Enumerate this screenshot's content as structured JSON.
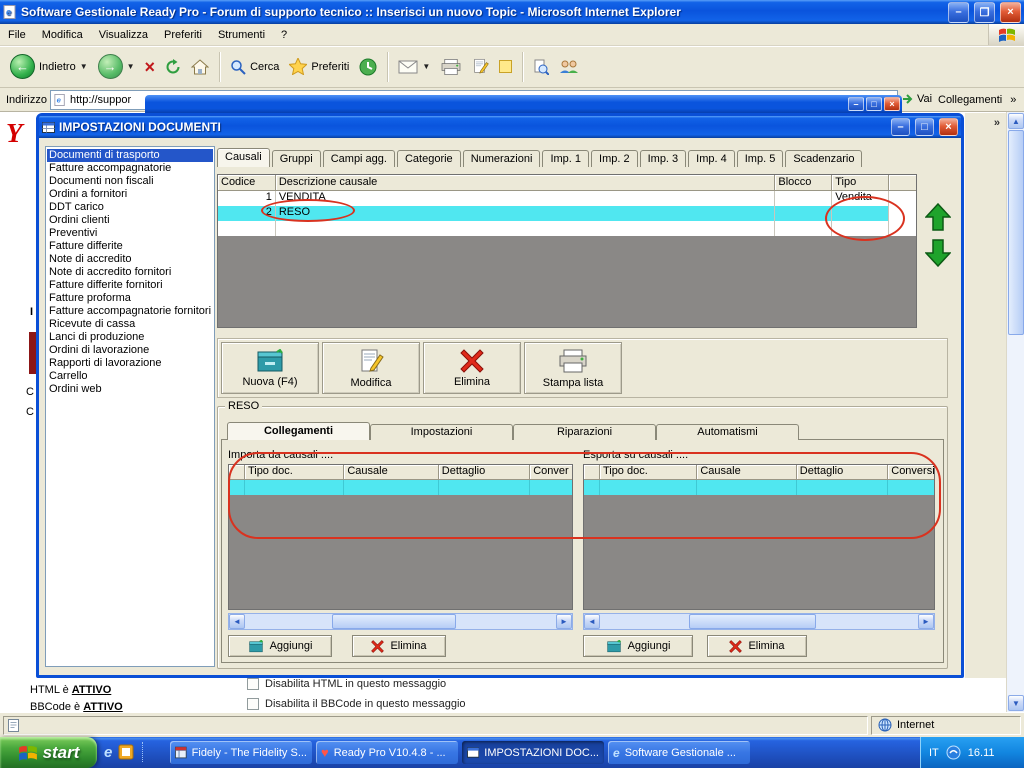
{
  "colors": {
    "titlebar_blue": "#0a54dd",
    "selection_cyan": "#50e7f0",
    "selection_navy": "#2456c9",
    "annotation_red": "#d9321f",
    "taskbar_blue": "#2663e0",
    "start_green": "#2f8a2d",
    "grid_void_gray": "#8a8886"
  },
  "browser": {
    "window_title": "Software Gestionale Ready Pro - Forum di supporto tecnico :: Inserisci un nuovo Topic - Microsoft Internet Explorer",
    "menu_items": [
      "File",
      "Modifica",
      "Visualizza",
      "Preferiti",
      "Strumenti",
      "?"
    ],
    "toolbar": {
      "back": "Indietro",
      "search": "Cerca",
      "favorites": "Preferiti"
    },
    "address": {
      "label": "Indirizzo",
      "value": "http://suppor",
      "go": "Vai",
      "links": "Collegamenti"
    },
    "statusbar": {
      "zone": "Internet"
    }
  },
  "page": {
    "fragments": [
      "Y",
      "I",
      "C",
      "C"
    ],
    "checkbox_html": "Disabilita HTML in questo messaggio",
    "checkbox_bbcode": "Disabilita il BBCode in questo messaggio",
    "html_status_prefix": "HTML è",
    "html_status_value": "ATTIVO",
    "bbcode_status_prefix": "BBCode è",
    "bbcode_status_value": "ATTIVO"
  },
  "dialog": {
    "title": "IMPOSTAZIONI DOCUMENTI",
    "sidebar_items": [
      "Documenti di trasporto",
      "Fatture accompagnatorie",
      "Documenti non fiscali",
      "Ordini a fornitori",
      "DDT carico",
      "Ordini clienti",
      "Preventivi",
      "Fatture differite",
      "Note di accredito",
      "Note di accredito fornitori",
      "Fatture differite fornitori",
      "Fatture proforma",
      "Fatture accompagnatorie fornitori",
      "Ricevute di cassa",
      "Lanci di produzione",
      "Ordini di lavorazione",
      "Rapporti di lavorazione",
      "Carrello",
      "Ordini web"
    ],
    "tabs": [
      "Causali",
      "Gruppi",
      "Campi agg.",
      "Categorie",
      "Numerazioni",
      "Imp. 1",
      "Imp. 2",
      "Imp. 3",
      "Imp. 4",
      "Imp. 5",
      "Scadenzario"
    ],
    "grid": {
      "headers": [
        "Codice",
        "Descrizione causale",
        "Blocco",
        "Tipo"
      ],
      "rows": [
        [
          "1",
          "VENDITA",
          "",
          "Vendita"
        ],
        [
          "2",
          "RESO",
          "",
          ""
        ]
      ]
    },
    "action_buttons": [
      "Nuova (F4)",
      "Modifica",
      "Elimina",
      "Stampa lista"
    ],
    "groupbox": {
      "title": "RESO",
      "tabs": [
        "Collegamenti",
        "Impostazioni",
        "Riparazioni",
        "Automatismi"
      ],
      "import": {
        "label": "Importa da causali ....",
        "headers": [
          "",
          "Tipo doc.",
          "Causale",
          "Dettaglio",
          "Conver"
        ],
        "add": "Aggiungi",
        "remove": "Elimina"
      },
      "export": {
        "label": "Esporta su causali ....",
        "headers": [
          "",
          "Tipo doc.",
          "Causale",
          "Dettaglio",
          "Conversi"
        ],
        "add": "Aggiungi",
        "remove": "Elimina"
      }
    }
  },
  "taskbar": {
    "start_label": "start",
    "tasks": [
      {
        "label": "Fidely - The Fidelity S..."
      },
      {
        "label": "Ready Pro V10.4.8 - ..."
      },
      {
        "label": "IMPOSTAZIONI DOC..."
      },
      {
        "label": "Software Gestionale ..."
      }
    ],
    "tray": {
      "lang": "IT",
      "time": "16.11"
    }
  }
}
